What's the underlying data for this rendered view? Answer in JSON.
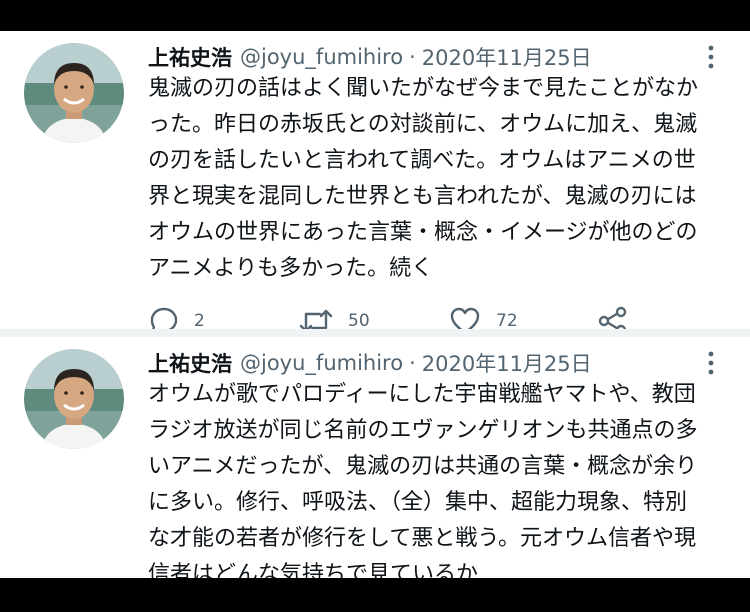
{
  "tweets": [
    {
      "author": {
        "name": "上祐史浩",
        "handle": "@joyu_fumihiro"
      },
      "separator": "·",
      "date": "2020年11月25日",
      "body_lines": [
        "鬼滅の刃の話はよく聞いたがなぜ今まで見たことがなか",
        "った。昨日の赤坂氏との対談前に、オウムに加え、鬼滅",
        "の刃を話したいと言われて調べた。オウムはアニメの世",
        "界と現実を混同した世界とも言われたが、鬼滅の刃には",
        "オウムの世界にあった言葉・概念・イメージが他のどの",
        "アニメよりも多かった。続く"
      ],
      "stats": {
        "replies": "2",
        "retweets": "50",
        "likes": "72"
      }
    },
    {
      "author": {
        "name": "上祐史浩",
        "handle": "@joyu_fumihiro"
      },
      "separator": "·",
      "date": "2020年11月25日",
      "body_lines": [
        "オウムが歌でパロディーにした宇宙戦艦ヤマトや、教団",
        "ラジオ放送が同じ名前のエヴァンゲリオンも共通点の多",
        "いアニメだったが、鬼滅の刃は共通の言葉・概念が余り",
        "に多い。修行、呼吸法、（全）集中、超能力現象、特別",
        "な才能の若者が修行をして悪と戦う。元オウム信者や現",
        "信者はどんな気持ちで見ているか"
      ]
    }
  ],
  "icons": {
    "reply": "speech-bubble-icon",
    "retweet": "retweet-arrows-icon",
    "like": "heart-outline-icon",
    "share": "share-nodes-icon",
    "more": "vertical-ellipsis-icon"
  },
  "colors": {
    "text": "#0f1419",
    "secondary": "#536471",
    "divider": "#eff3f4",
    "frame": "#000000"
  }
}
